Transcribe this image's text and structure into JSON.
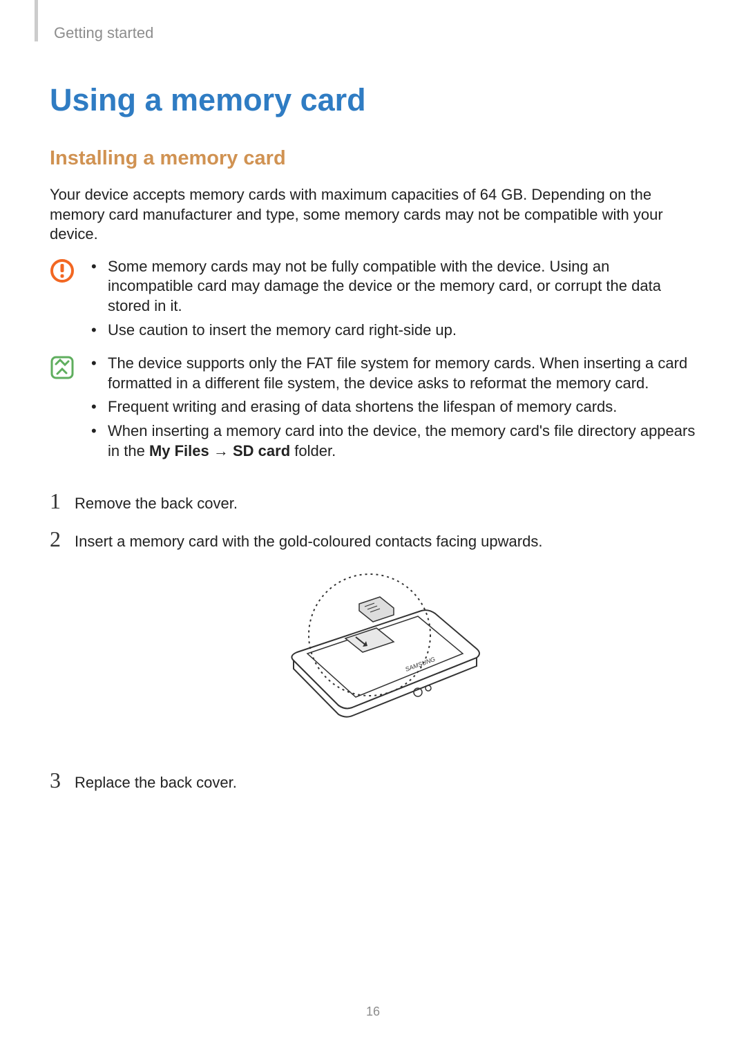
{
  "breadcrumb": "Getting started",
  "h1": "Using a memory card",
  "h2": "Installing a memory card",
  "intro": "Your device accepts memory cards with maximum capacities of 64 GB. Depending on the memory card manufacturer and type, some memory cards may not be compatible with your device.",
  "caution": {
    "items": [
      "Some memory cards may not be fully compatible with the device. Using an incompatible card may damage the device or the memory card, or corrupt the data stored in it.",
      "Use caution to insert the memory card right-side up."
    ]
  },
  "note": {
    "items": [
      "The device supports only the FAT file system for memory cards. When inserting a card formatted in a different file system, the device asks to reformat the memory card.",
      "Frequent writing and erasing of data shortens the lifespan of memory cards."
    ],
    "item3_prefix": "When inserting a memory card into the device, the memory card's file directory appears in the ",
    "item3_bold1": "My Files",
    "item3_arrow": " → ",
    "item3_bold2": "SD card",
    "item3_suffix": " folder."
  },
  "steps": {
    "s1_num": "1",
    "s1_text": "Remove the back cover.",
    "s2_num": "2",
    "s2_text": "Insert a memory card with the gold-coloured contacts facing upwards.",
    "s3_num": "3",
    "s3_text": "Replace the back cover."
  },
  "page_number": "16"
}
